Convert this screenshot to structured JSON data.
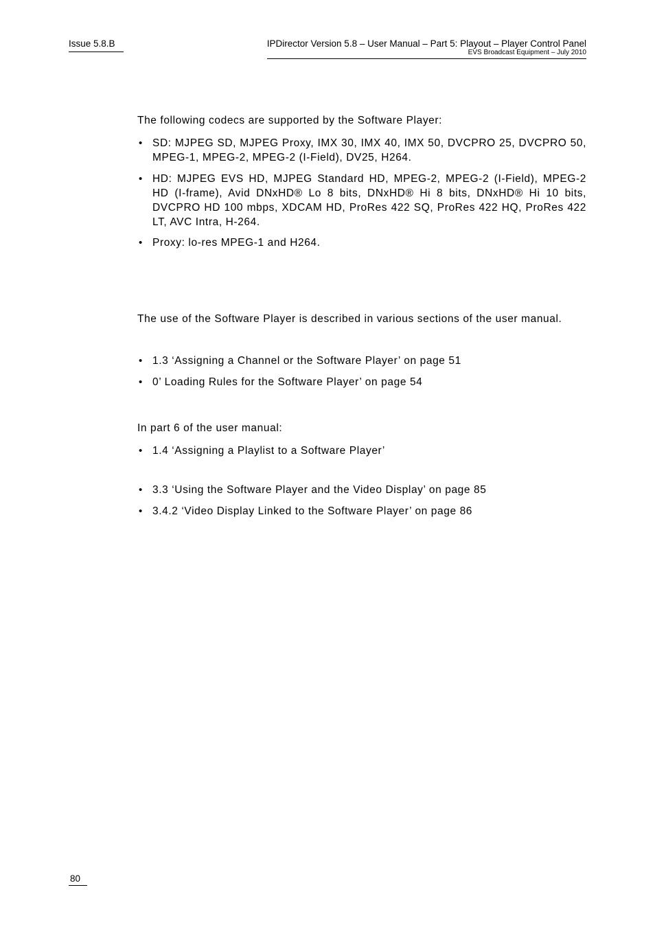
{
  "header": {
    "issue": "Issue 5.8.B",
    "title_line": "IPDirector Version 5.8 – User Manual – Part 5: Playout – Player Control Panel",
    "sub_line": "EVS Broadcast Equipment – July 2010"
  },
  "body": {
    "intro1": "The following codecs are supported by the Software Player:",
    "codec_list": [
      "SD: MJPEG SD, MJPEG Proxy, IMX 30, IMX 40, IMX 50, DVCPRO 25, DVCPRO 50, MPEG-1, MPEG-2, MPEG-2 (I-Field), DV25, H264.",
      "HD: MJPEG EVS HD, MJPEG Standard HD, MPEG-2, MPEG-2 (I-Field), MPEG-2 HD (I-frame), Avid DNxHD® Lo 8 bits, DNxHD® Hi 8 bits, DNxHD® Hi 10 bits, DVCPRO HD 100 mbps, XDCAM HD, ProRes 422 SQ, ProRes 422 HQ, ProRes 422 LT, AVC Intra, H-264.",
      "Proxy: lo-res MPEG-1 and H264."
    ],
    "intro2": "The use of the Software Player is described in various sections of the user manual.",
    "ref_list_1": [
      "1.3 ‘Assigning a Channel or the Software Player’ on page 51",
      "0’ Loading Rules for the Software Player’ on page 54"
    ],
    "intro3": "In part 6 of the user manual:",
    "ref_list_2": [
      "1.4 ‘Assigning a Playlist to a Software Player’"
    ],
    "ref_list_3": [
      "3.3 ‘Using the Software Player and the Video Display’ on page 85",
      "3.4.2 ‘Video Display Linked to the Software Player’ on page 86"
    ]
  },
  "footer": {
    "page_number": "80"
  }
}
